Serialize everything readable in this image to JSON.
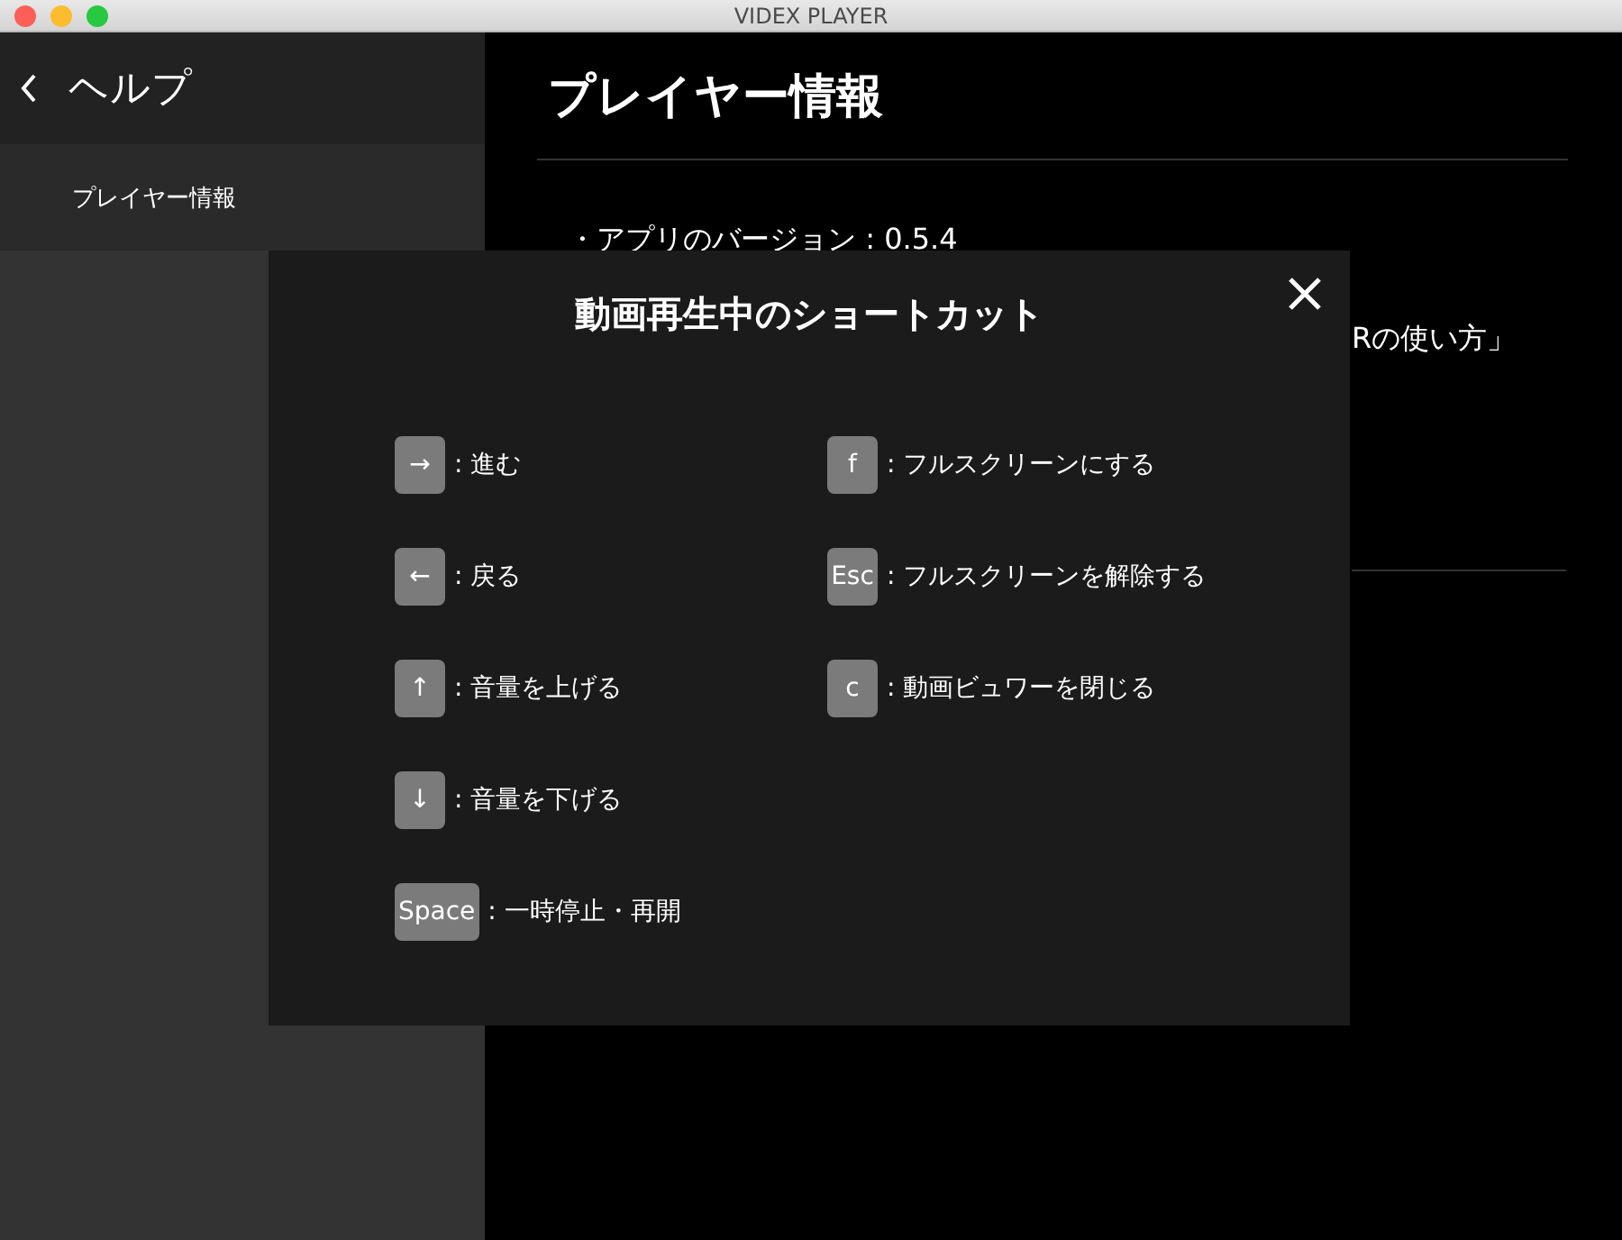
{
  "window": {
    "title": "VIDEX PLAYER"
  },
  "sidebar": {
    "back_label": "ヘルプ",
    "items": [
      {
        "label": "プレイヤー情報",
        "selected": true
      }
    ]
  },
  "main": {
    "title": "プレイヤー情報",
    "version_line": "・アプリのバージョン : 0.5.4",
    "partial_line": "Rの使い方」"
  },
  "dialog": {
    "title": "動画再生中のショートカット",
    "columns": [
      [
        {
          "key": "→",
          "action": ": 進む"
        },
        {
          "key": "←",
          "action": ": 戻る"
        },
        {
          "key": "↑",
          "action": ": 音量を上げる"
        },
        {
          "key": "↓",
          "action": ": 音量を下げる"
        },
        {
          "key": "Space",
          "action": ": 一時停止・再開"
        }
      ],
      [
        {
          "key": "f",
          "action": ": フルスクリーンにする"
        },
        {
          "key": "Esc",
          "action": ": フルスクリーンを解除する"
        },
        {
          "key": "c",
          "action": ": 動画ビュワーを閉じる"
        }
      ]
    ]
  }
}
